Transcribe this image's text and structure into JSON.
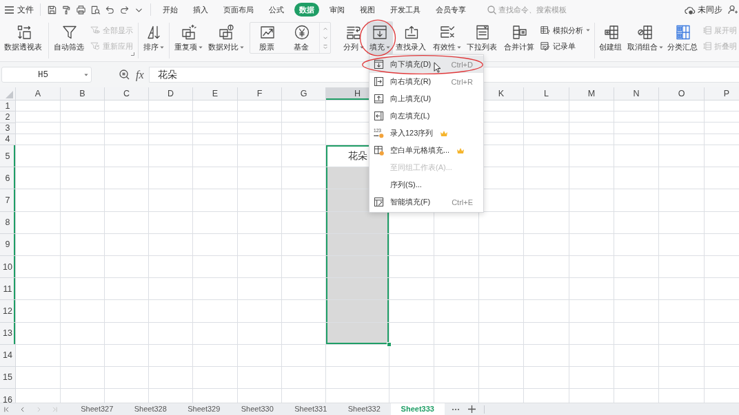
{
  "menu_bar": {
    "file_menu": "文件",
    "tabs": [
      {
        "label": "开始",
        "selected": false
      },
      {
        "label": "插入",
        "selected": false
      },
      {
        "label": "页面布局",
        "selected": false
      },
      {
        "label": "公式",
        "selected": false
      },
      {
        "label": "数据",
        "selected": true
      },
      {
        "label": "审阅",
        "selected": false
      },
      {
        "label": "视图",
        "selected": false
      },
      {
        "label": "开发工具",
        "selected": false
      },
      {
        "label": "会员专享",
        "selected": false
      }
    ],
    "search": {
      "placeholder": "查找命令、搜索模板"
    },
    "sync_status": "未同步"
  },
  "ribbon": {
    "groups": [
      {
        "items": [
          {
            "kind": "pivot",
            "label": "数据透视表",
            "has_menu": false,
            "disabled": false
          }
        ]
      },
      {
        "launcher": true,
        "items": [
          {
            "kind": "filter",
            "label": "自动筛选",
            "has_menu": false,
            "disabled": false
          },
          {
            "kind": "showall",
            "label": "全部显示",
            "has_menu": false,
            "disabled": true
          },
          {
            "kind": "reapply",
            "label": "重新应用",
            "has_menu": false,
            "disabled": true
          }
        ]
      },
      {
        "items": [
          {
            "kind": "sort",
            "label": "排序",
            "has_menu": true,
            "disabled": false
          }
        ]
      },
      {
        "items": [
          {
            "kind": "duplicates",
            "label": "重复项",
            "has_menu": true,
            "disabled": false
          },
          {
            "kind": "compare",
            "label": "数据对比",
            "has_menu": true,
            "disabled": false
          },
          {
            "kind": "gallery",
            "entries": [
              {
                "kind": "stock",
                "label": "股票"
              },
              {
                "kind": "fund",
                "label": "基金"
              }
            ]
          },
          {
            "kind": "split",
            "label": "分列",
            "has_menu": true,
            "disabled": false
          },
          {
            "kind": "fill",
            "label": "填充",
            "has_menu": true,
            "disabled": false,
            "pressed": true,
            "circled": true,
            "menu": {
              "items": [
                {
                  "kind": "down",
                  "label": "向下填充(D)",
                  "shortcut": "Ctrl+D",
                  "highlighted": true,
                  "circled": true,
                  "disabled": false
                },
                {
                  "kind": "right",
                  "label": "向右填充(R)",
                  "shortcut": "Ctrl+R",
                  "highlighted": false,
                  "disabled": false
                },
                {
                  "kind": "up",
                  "label": "向上填充(U)",
                  "highlighted": false,
                  "disabled": false
                },
                {
                  "kind": "left",
                  "label": "向左填充(L)",
                  "highlighted": false,
                  "disabled": false
                },
                {
                  "kind": "numbers",
                  "icon_text": "123",
                  "label": "录入123序列",
                  "highlighted": false,
                  "disabled": false,
                  "premium": true
                },
                {
                  "kind": "blanks",
                  "label": "空白单元格填充...",
                  "highlighted": false,
                  "disabled": false,
                  "premium": true
                },
                {
                  "kind": "plain",
                  "label": "至同组工作表(A)...",
                  "highlighted": false,
                  "disabled": true
                },
                {
                  "kind": "plain",
                  "label": "序列(S)...",
                  "highlighted": false,
                  "disabled": false
                },
                {
                  "kind": "smart",
                  "label": "智能填充(F)",
                  "shortcut": "Ctrl+E",
                  "highlighted": false,
                  "disabled": false
                }
              ]
            }
          },
          {
            "kind": "lookup",
            "label": "查找录入",
            "has_menu": false,
            "disabled": false
          },
          {
            "kind": "validity",
            "label": "有效性",
            "has_menu": true,
            "disabled": false
          },
          {
            "kind": "dropdown",
            "label": "下拉列表",
            "has_menu": false,
            "disabled": false
          },
          {
            "kind": "consolidate",
            "label": "合并计算",
            "has_menu": false,
            "disabled": false
          },
          {
            "kind": "whatif",
            "label": "模拟分析",
            "has_menu": true,
            "disabled": false
          },
          {
            "kind": "record",
            "label": "记录单",
            "has_menu": false,
            "disabled": false
          }
        ]
      },
      {
        "items": [
          {
            "kind": "group",
            "label": "创建组",
            "has_menu": false,
            "disabled": false
          },
          {
            "kind": "ungroup",
            "label": "取消组合",
            "has_menu": true,
            "disabled": false
          },
          {
            "kind": "subtotal",
            "label": "分类汇总",
            "has_menu": false,
            "disabled": false
          },
          {
            "kind": "expand",
            "label": "展开明",
            "has_menu": false,
            "disabled": true
          },
          {
            "kind": "collapse",
            "label": "折叠明",
            "has_menu": false,
            "disabled": true
          }
        ]
      }
    ]
  },
  "formula_bar": {
    "name_box": "H5",
    "function_label": "fx",
    "value": "花朵"
  },
  "sheet": {
    "columns": {
      "before_menu": [
        {
          "label": "A",
          "selected": false
        },
        {
          "label": "B",
          "selected": false
        },
        {
          "label": "C",
          "selected": false
        },
        {
          "label": "D",
          "selected": false
        },
        {
          "label": "E",
          "selected": false
        },
        {
          "label": "F",
          "selected": false
        },
        {
          "label": "G",
          "selected": false
        },
        {
          "label": "H",
          "selected": true
        }
      ],
      "after_menu": [
        {
          "label": "K",
          "selected": false
        },
        {
          "label": "L",
          "selected": false
        },
        {
          "label": "M",
          "selected": false
        },
        {
          "label": "N",
          "selected": false
        },
        {
          "label": "O",
          "selected": false
        },
        {
          "label": "P",
          "selected": false
        }
      ]
    },
    "rows": [
      {
        "label": "1",
        "selected": false
      },
      {
        "label": "2",
        "selected": false
      },
      {
        "label": "3",
        "selected": false
      },
      {
        "label": "4",
        "selected": false
      },
      {
        "label": "5",
        "selected": true
      },
      {
        "label": "6",
        "selected": true
      },
      {
        "label": "7",
        "selected": true
      },
      {
        "label": "8",
        "selected": true
      },
      {
        "label": "9",
        "selected": true
      },
      {
        "label": "10",
        "selected": true
      },
      {
        "label": "11",
        "selected": true
      },
      {
        "label": "12",
        "selected": true
      },
      {
        "label": "13",
        "selected": true
      },
      {
        "label": "14",
        "selected": false
      },
      {
        "label": "15",
        "selected": false
      },
      {
        "label": "16",
        "selected": false
      }
    ],
    "active_cell_text": "花朵"
  },
  "sheet_nav": [
    {
      "kind": "first",
      "disabled": false
    },
    {
      "kind": "previous",
      "disabled": false
    },
    {
      "kind": "next",
      "disabled": true
    },
    {
      "kind": "last",
      "disabled": true
    }
  ],
  "sheet_tabs": [
    {
      "label": "Sheet327",
      "selected": false
    },
    {
      "label": "Sheet328",
      "selected": false
    },
    {
      "label": "Sheet329",
      "selected": false
    },
    {
      "label": "Sheet330",
      "selected": false
    },
    {
      "label": "Sheet331",
      "selected": false
    },
    {
      "label": "Sheet332",
      "selected": false
    },
    {
      "label": "Sheet333",
      "selected": true
    }
  ]
}
